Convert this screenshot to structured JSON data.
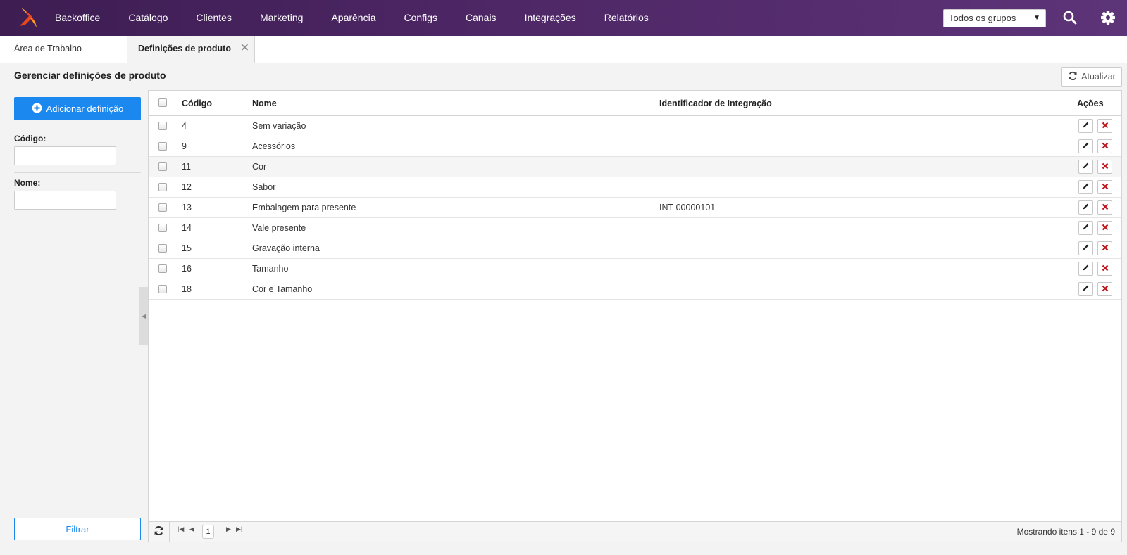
{
  "nav": {
    "items": [
      "Backoffice",
      "Catálogo",
      "Clientes",
      "Marketing",
      "Aparência",
      "Configs",
      "Canais",
      "Integrações",
      "Relatórios"
    ],
    "group_select": "Todos os grupos"
  },
  "tabs": {
    "desktop": "Área de Trabalho",
    "active": "Definições de produto"
  },
  "page": {
    "title": "Gerenciar definições de produto",
    "refresh_label": "Atualizar"
  },
  "filters": {
    "add_label": "Adicionar definição",
    "code_label": "Código:",
    "name_label": "Nome:",
    "code_value": "",
    "name_value": "",
    "filter_label": "Filtrar"
  },
  "grid": {
    "headers": {
      "code": "Código",
      "name": "Nome",
      "integration": "Identificador de Integração",
      "actions": "Ações"
    },
    "rows": [
      {
        "code": "4",
        "name": "Sem variação",
        "integration": ""
      },
      {
        "code": "9",
        "name": "Acessórios",
        "integration": ""
      },
      {
        "code": "11",
        "name": "Cor",
        "integration": ""
      },
      {
        "code": "12",
        "name": "Sabor",
        "integration": ""
      },
      {
        "code": "13",
        "name": "Embalagem para presente",
        "integration": "INT-00000101"
      },
      {
        "code": "14",
        "name": "Vale presente",
        "integration": ""
      },
      {
        "code": "15",
        "name": "Gravação interna",
        "integration": ""
      },
      {
        "code": "16",
        "name": "Tamanho",
        "integration": ""
      },
      {
        "code": "18",
        "name": "Cor e Tamanho",
        "integration": ""
      }
    ]
  },
  "pager": {
    "page": "1",
    "info": "Mostrando itens 1 - 9 de 9"
  },
  "colors": {
    "header_bg": "#4e2766",
    "primary": "#1b88f0",
    "delete": "#c0141a"
  }
}
